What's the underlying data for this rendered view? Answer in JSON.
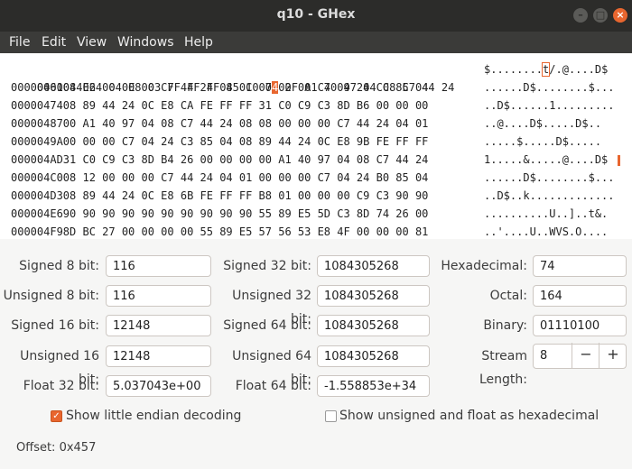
{
  "window": {
    "title": "q10 - GHex"
  },
  "menu": [
    "File",
    "Edit",
    "View",
    "Windows",
    "Help"
  ],
  "hex": {
    "rows": [
      {
        "addr": "0000044E24",
        "bytes_pre": "04 E8 03 FF FF FF 85 C0 7",
        "bytes_cur": "4",
        "bytes_post": " 2F A1 40 97 04 08 C7 44 24",
        "ascii_pre": "$........",
        "ascii_cur": "t",
        "ascii_post": "/.@....D$"
      },
      {
        "addr": "0000046108",
        "bytes": "06 00 00 00 C7 44 24 04 01 00 00 00 C7 04 24 CC 85 04",
        "ascii": "......D$........$..."
      },
      {
        "addr": "0000047408",
        "bytes": "89 44 24 0C E8 CA FE FF FF 31 C0 C9 C3 8D B6 00 00 00",
        "ascii": "..D$......1........."
      },
      {
        "addr": "0000048700",
        "bytes": "A1 40 97 04 08 C7 44 24 08 08 00 00 00 C7 44 24 04 01",
        "ascii": "..@....D$.....D$.."
      },
      {
        "addr": "0000049A00",
        "bytes": "00 00 C7 04 24 C3 85 04 08 89 44 24 0C E8 9B FE FF FF",
        "ascii": ".....$.....D$....."
      },
      {
        "addr": "000004AD31",
        "bytes": "C0 C9 C3 8D B4 26 00 00 00 00 A1 40 97 04 08 C7 44 24",
        "ascii": "1.....&.....@....D$"
      },
      {
        "addr": "000004C008",
        "bytes": "12 00 00 00 C7 44 24 04 01 00 00 00 C7 04 24 B0 85 04",
        "ascii": "......D$........$..."
      },
      {
        "addr": "000004D308",
        "bytes": "89 44 24 0C E8 6B FE FF FF B8 01 00 00 00 C9 C3 90 90",
        "ascii": "..D$..k............."
      },
      {
        "addr": "000004E690",
        "bytes": "90 90 90 90 90 90 90 90 90 55 89 E5 5D C3 8D 74 26 00",
        "ascii": "..........U..]..t&."
      },
      {
        "addr": "000004F98D",
        "bytes": "BC 27 00 00 00 00 55 89 E5 57 56 53 E8 4F 00 00 00 81",
        "ascii": "..'....U..WVS.O...."
      }
    ]
  },
  "values": {
    "signed8_label": "Signed 8 bit:",
    "signed8": "116",
    "unsigned8_label": "Unsigned 8 bit:",
    "unsigned8": "116",
    "signed16_label": "Signed 16 bit:",
    "signed16": "12148",
    "unsigned16_label": "Unsigned 16 bit:",
    "unsigned16": "12148",
    "float32_label": "Float 32 bit:",
    "float32": "5.037043e+00",
    "signed32_label": "Signed 32 bit:",
    "signed32": "1084305268",
    "unsigned32_label": "Unsigned 32 bit:",
    "unsigned32": "1084305268",
    "signed64_label": "Signed 64 bit:",
    "signed64": "1084305268",
    "unsigned64_label": "Unsigned 64 bit:",
    "unsigned64": "1084305268",
    "float64_label": "Float 64 bit:",
    "float64": "-1.558853e+34",
    "hex_label": "Hexadecimal:",
    "hex": "74",
    "octal_label": "Octal:",
    "octal": "164",
    "binary_label": "Binary:",
    "binary": "01110100",
    "stream_label": "Stream Length:",
    "stream": "8"
  },
  "options": {
    "little_endian_label": "Show little endian decoding",
    "little_endian_checked": true,
    "unsigned_hex_label": "Show unsigned and float as hexadecimal",
    "unsigned_hex_checked": false
  },
  "status": {
    "offset": "Offset: 0x457"
  },
  "colors": {
    "accent": "#e8662f",
    "titlebar": "#2c2c2a",
    "menubar": "#3b3b39"
  }
}
